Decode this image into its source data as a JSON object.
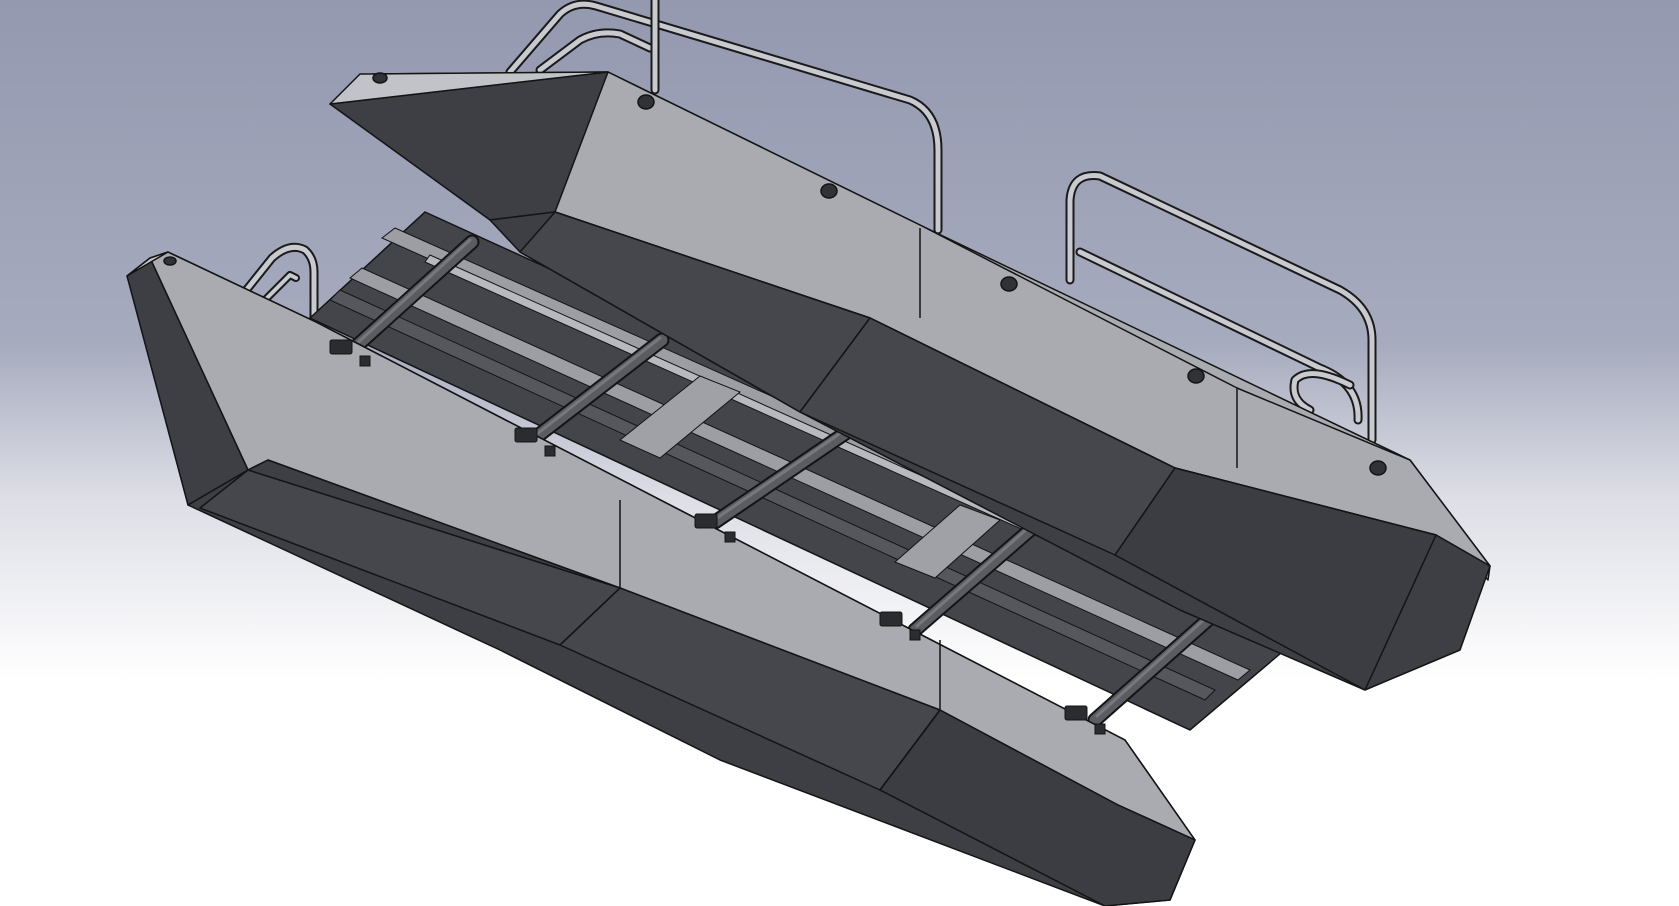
{
  "viewport": {
    "background_top": "#9499b0",
    "background_bottom": "#ffffff"
  },
  "model": {
    "description_icon": "pontoon-boat-assembly-icon",
    "colors": {
      "hull_dark": "#3d3f44",
      "hull_mid": "#4a4c52",
      "hull_side": "#55575d",
      "deck_top": "#a9abb1",
      "deck_light": "#c2c3c8",
      "edge": "#141414",
      "rail": "#c9cad0",
      "crossbar": "#5a5c62"
    }
  }
}
